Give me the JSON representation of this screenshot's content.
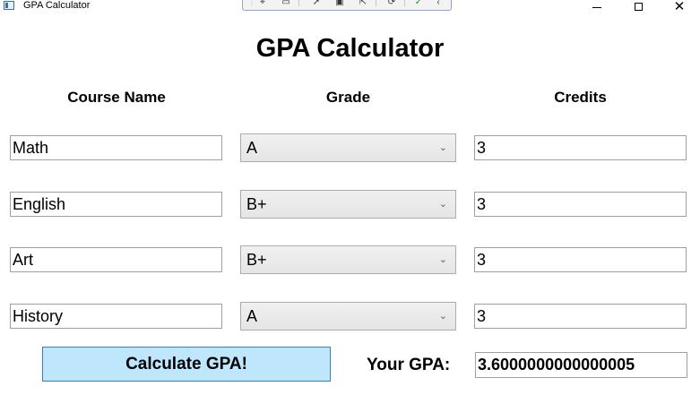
{
  "window": {
    "title": "GPA Calculator"
  },
  "page": {
    "heading": "GPA Calculator"
  },
  "columns": {
    "course": "Course Name",
    "grade": "Grade",
    "credits": "Credits"
  },
  "rows": [
    {
      "course": "Math",
      "grade": "A",
      "credits": "3"
    },
    {
      "course": "English",
      "grade": "B+",
      "credits": "3"
    },
    {
      "course": "Art",
      "grade": "B+",
      "credits": "3"
    },
    {
      "course": "History",
      "grade": "A",
      "credits": "3"
    }
  ],
  "actions": {
    "calculate_label": "Calculate GPA!"
  },
  "result": {
    "label": "Your GPA:",
    "value": "3.6000000000000005"
  },
  "colors": {
    "button_bg": "#bee6fd",
    "button_border": "#3c7fb1",
    "input_border": "#a0a0a0"
  }
}
